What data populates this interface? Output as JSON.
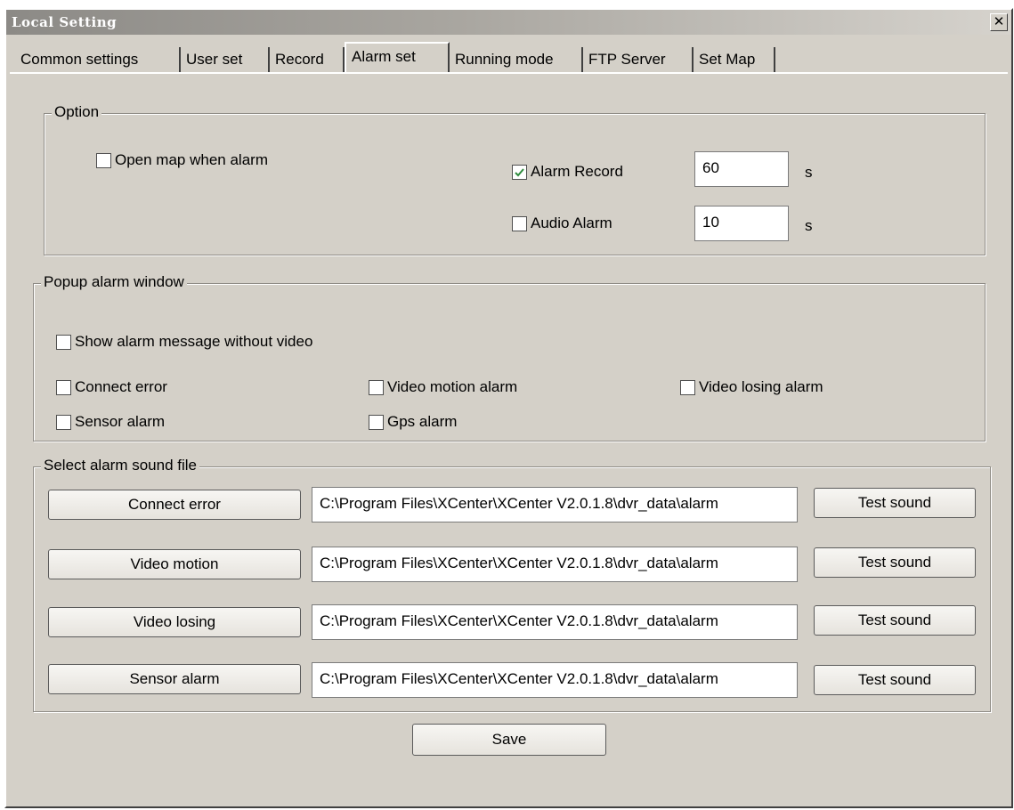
{
  "window": {
    "title": "Local Setting",
    "close_glyph": "✕"
  },
  "tabs": [
    {
      "label": "Common settings"
    },
    {
      "label": "User set"
    },
    {
      "label": "Record"
    },
    {
      "label": "Alarm set"
    },
    {
      "label": "Running mode"
    },
    {
      "label": "FTP Server"
    },
    {
      "label": "Set Map"
    }
  ],
  "active_tab": "Alarm set",
  "option": {
    "legend": "Option",
    "open_map": {
      "label": "Open map when alarm",
      "checked": false
    },
    "alarm_record": {
      "label": "Alarm Record",
      "checked": true,
      "value": "60",
      "unit": "s"
    },
    "audio_alarm": {
      "label": "Audio Alarm",
      "checked": false,
      "value": "10",
      "unit": "s"
    }
  },
  "popup": {
    "legend": "Popup alarm window",
    "show_without_video": {
      "label": "Show alarm message without video",
      "checked": false
    },
    "connect_error": {
      "label": "Connect error",
      "checked": false
    },
    "video_motion": {
      "label": "Video motion alarm",
      "checked": false
    },
    "video_losing": {
      "label": "Video losing alarm",
      "checked": false
    },
    "sensor_alarm": {
      "label": "Sensor alarm",
      "checked": false
    },
    "gps_alarm": {
      "label": "Gps alarm",
      "checked": false
    }
  },
  "sound": {
    "legend": "Select alarm sound file",
    "rows": [
      {
        "button": "Connect error",
        "path": "C:\\Program Files\\XCenter\\XCenter V2.0.1.8\\dvr_data\\alarm",
        "test": "Test sound"
      },
      {
        "button": "Video motion",
        "path": "C:\\Program Files\\XCenter\\XCenter V2.0.1.8\\dvr_data\\alarm",
        "test": "Test sound"
      },
      {
        "button": "Video losing",
        "path": "C:\\Program Files\\XCenter\\XCenter V2.0.1.8\\dvr_data\\alarm",
        "test": "Test sound"
      },
      {
        "button": "Sensor alarm",
        "path": "C:\\Program Files\\XCenter\\XCenter V2.0.1.8\\dvr_data\\alarm",
        "test": "Test sound"
      }
    ]
  },
  "save_label": "Save",
  "colors": {
    "dialog_bg": "#d4d0c8",
    "check_mark": "#2e8b3d"
  }
}
